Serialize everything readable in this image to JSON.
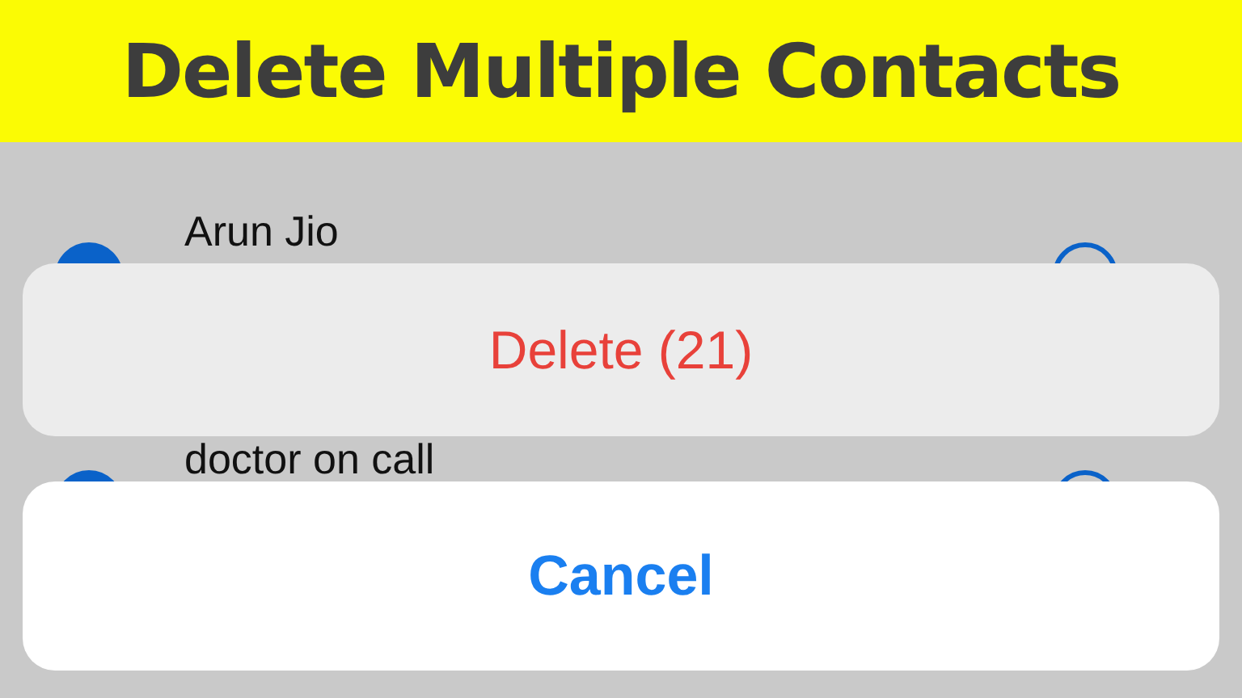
{
  "banner": {
    "title": "Delete Multiple Contacts"
  },
  "contacts": [
    {
      "name": "Arun Jio",
      "selected": true
    },
    {
      "name": "doctor on call",
      "selected": true
    }
  ],
  "action_sheet": {
    "delete_label": "Delete (21)",
    "cancel_label": "Cancel"
  }
}
